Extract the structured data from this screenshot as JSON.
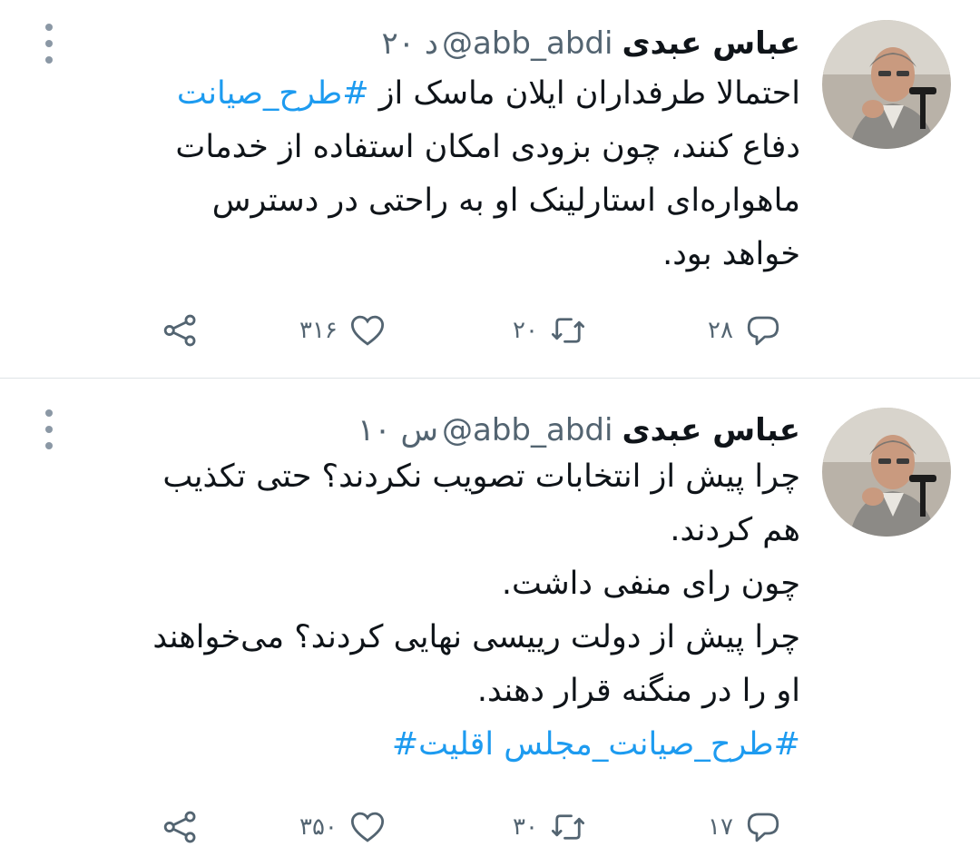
{
  "tweets": [
    {
      "author_name": "عباس عبدی",
      "handle": "@abb_abdi",
      "time": "۲۰ د",
      "body": {
        "lines": [
          {
            "prefix": "احتمالا طرفداران ایلان ماسک از ",
            "hashtag": "#طرح_صیانت"
          },
          {
            "text": "دفاع کنند، چون بزودی امکان استفاده از خدمات"
          },
          {
            "text": "ماهواره‌ای استارلینک او به راحتی در دسترس"
          },
          {
            "text": "خواهد بود."
          }
        ]
      },
      "stats": {
        "replies": "۲۸",
        "retweets": "۲۰",
        "likes": "۳۱۶"
      }
    },
    {
      "author_name": "عباس عبدی",
      "handle": "@abb_abdi",
      "time": "۱۰ س",
      "body": {
        "lines": [
          {
            "text": "چرا پیش از انتخابات تصویب نکردند؟ حتی تکذیب"
          },
          {
            "text": "هم کردند."
          },
          {
            "text": "چون رای منفی داشت."
          },
          {
            "text": "چرا پیش از دولت رییسی نهایی کردند؟ می‌خواهند"
          },
          {
            "text": "او را در منگنه قرار دهند."
          }
        ],
        "hashtag_line": {
          "hashtag1": "#طرح_صیانت_مجلس",
          "hashtag2": "اقلیت#"
        }
      },
      "stats": {
        "replies": "۱۷",
        "retweets": "۳۰",
        "likes": "۳۵۰"
      }
    }
  ],
  "icons": {
    "more": "more-vertical-icon",
    "reply": "reply-icon",
    "retweet": "retweet-icon",
    "like": "heart-icon",
    "share": "share-icon"
  },
  "colors": {
    "text": "#0f1419",
    "secondary": "#536471",
    "hashtag": "#1d9bf0",
    "divider": "#dfe3e6"
  }
}
